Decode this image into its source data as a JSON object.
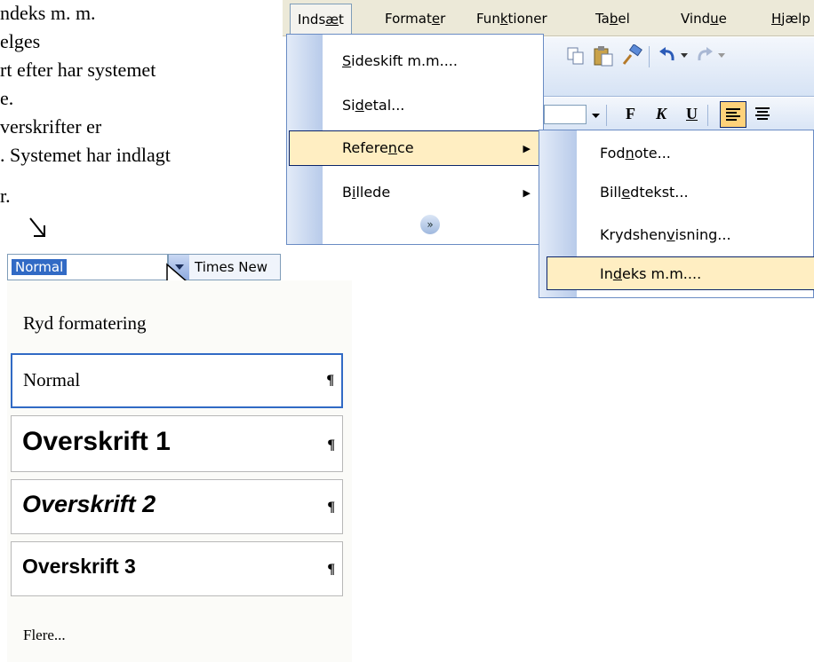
{
  "document": {
    "lines": [
      "ndeks m. m.",
      "elges",
      "rt efter har systemet",
      "e.",
      "verskrifter er",
      ". Systemet har indlagt",
      "r."
    ]
  },
  "menubar": {
    "items": [
      {
        "pre": "Inds",
        "u": "æ",
        "post": "t"
      },
      {
        "pre": "Format",
        "u": "e",
        "post": "r"
      },
      {
        "pre": "Fun",
        "u": "k",
        "post": "tioner"
      },
      {
        "pre": "Ta",
        "u": "b",
        "post": "el"
      },
      {
        "pre": "Vind",
        "u": "u",
        "post": "e"
      },
      {
        "pre": "",
        "u": "H",
        "post": "jælp"
      }
    ]
  },
  "toolbar": {
    "bold_label": "F",
    "italic_label": "K",
    "underline_label": "U"
  },
  "insert_menu": {
    "items": [
      {
        "pre": "",
        "u": "S",
        "post": "ideskift m.m...."
      },
      {
        "pre": "Si",
        "u": "d",
        "post": "etal..."
      },
      {
        "pre": "Refere",
        "u": "n",
        "post": "ce"
      },
      {
        "pre": "B",
        "u": "i",
        "post": "llede"
      }
    ],
    "highlighted": "Reference"
  },
  "reference_submenu": {
    "items": [
      {
        "pre": "Fod",
        "u": "n",
        "post": "ote..."
      },
      {
        "pre": "Bill",
        "u": "e",
        "post": "dtekst..."
      },
      {
        "pre": "Krydshen",
        "u": "v",
        "post": "isning..."
      },
      {
        "pre": "In",
        "u": "d",
        "post": "eks m.m...."
      }
    ],
    "highlighted": "Indeks m.m...."
  },
  "style_combo": {
    "value": "Normal",
    "font_value": "Times New"
  },
  "style_list": {
    "clear_formatting": "Ryd formatering",
    "styles": [
      {
        "name": "Normal",
        "mark": "¶"
      },
      {
        "name": "Overskrift 1",
        "mark": "¶"
      },
      {
        "name": "Overskrift 2",
        "mark": "¶"
      },
      {
        "name": "Overskrift 3",
        "mark": "¶"
      }
    ],
    "more": "Flere..."
  },
  "colors": {
    "menu_highlight": "#ffeec2",
    "menu_border": "#0a246a",
    "selection_blue": "#316ac5",
    "menubar_bg": "#ece9d8"
  },
  "icons": [
    "down-arrow-icon",
    "submenu-arrow-icon",
    "expand-chevrons-icon",
    "mouse-pointer-icon",
    "copy-icon",
    "paste-icon",
    "format-painter-icon",
    "undo-icon",
    "redo-icon",
    "align-left-icon",
    "align-center-icon",
    "dropdown-arrow-icon"
  ]
}
